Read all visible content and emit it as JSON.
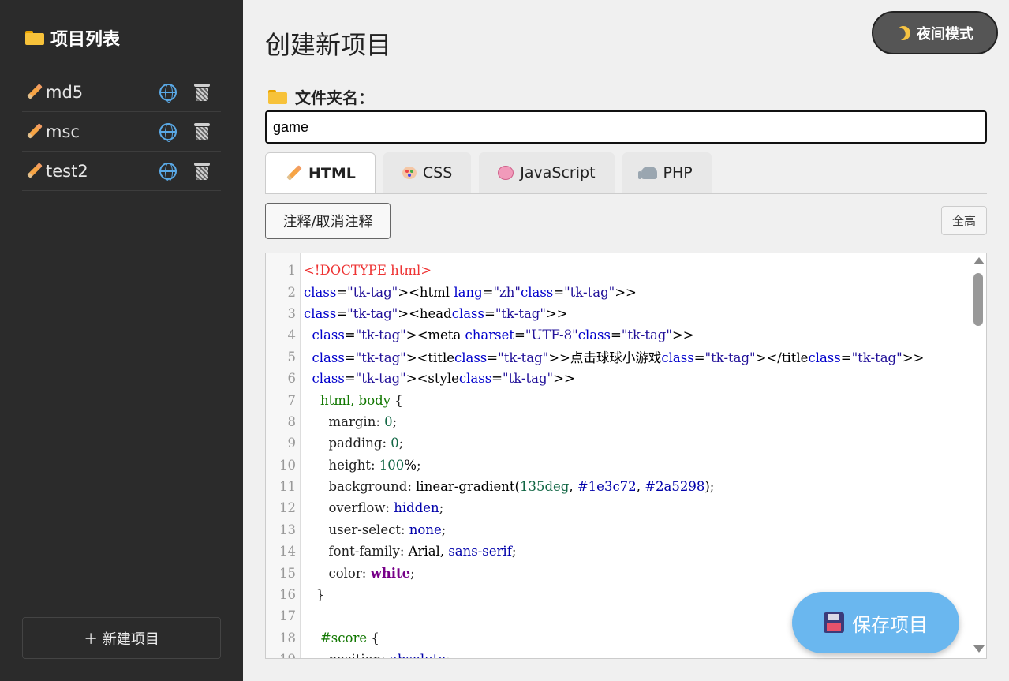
{
  "sidebar": {
    "title": "项目列表",
    "icon": "folder-icon",
    "projects": [
      {
        "name": "md5"
      },
      {
        "name": "msc"
      },
      {
        "name": "test2"
      }
    ],
    "new_project_label": "＋ 新建项目"
  },
  "header": {
    "title": "创建新项目",
    "night_mode_label": "夜间模式"
  },
  "form": {
    "folder_label": "文件夹名：",
    "folder_value": "game"
  },
  "tabs": [
    {
      "label": "HTML",
      "icon": "pencil-icon",
      "active": true
    },
    {
      "label": "CSS",
      "icon": "palette-icon",
      "active": false
    },
    {
      "label": "JavaScript",
      "icon": "brain-icon",
      "active": false
    },
    {
      "label": "PHP",
      "icon": "elephant-icon",
      "active": false
    }
  ],
  "toolbar": {
    "comment_label": "注释/取消注释",
    "full_height_label": "全高"
  },
  "save_label": "保存项目",
  "code_lines": [
    "<!DOCTYPE html>",
    "<html lang=\"zh\">",
    "<head>",
    "  <meta charset=\"UTF-8\">",
    "  <title>点击球球小游戏</title>",
    "  <style>",
    "    html, body {",
    "      margin: 0;",
    "      padding: 0;",
    "      height: 100%;",
    "      background: linear-gradient(135deg, #1e3c72, #2a5298);",
    "      overflow: hidden;",
    "      user-select: none;",
    "      font-family: Arial, sans-serif;",
    "      color: white;",
    "   }",
    "",
    "    #score {",
    "      position: absolute;"
  ],
  "colors": {
    "sidebar_bg": "#2b2b2b",
    "accent": "#6ab7ef",
    "tag": "#117700",
    "doctype": "#ee3333"
  }
}
